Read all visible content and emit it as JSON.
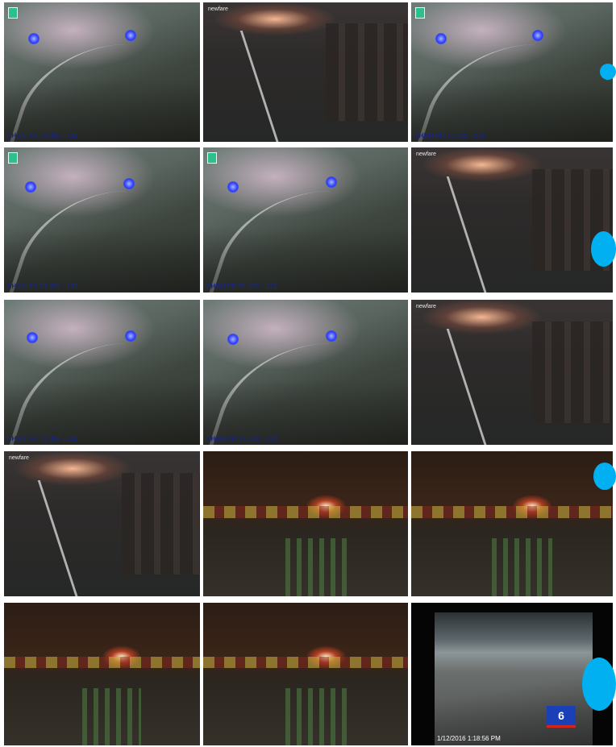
{
  "collage": {
    "row1": {
      "caption_left": "SHBN PR T1 382 - 132",
      "source_mid": "newfare",
      "caption_right": "SHBN PR T1 382 - 132"
    },
    "row2": {
      "caption_left": "SHBN PR T1 382 - 132",
      "caption_mid": "SHBN PR T1 382 - 132",
      "source_right": "newfare"
    },
    "row3": {
      "caption_left": "SHBN PR T1 382 - 132",
      "caption_mid": "SHBN PR T1 382 - 132",
      "source_right": "newfare"
    },
    "row4": {
      "source_left": "newfare"
    },
    "row5": {
      "news_logo": "6",
      "timestamp": "1/12/2016 1:18:56 PM"
    }
  },
  "colors": {
    "accent_dot": "#00b0f0",
    "caption_blue": "#2038d8"
  }
}
